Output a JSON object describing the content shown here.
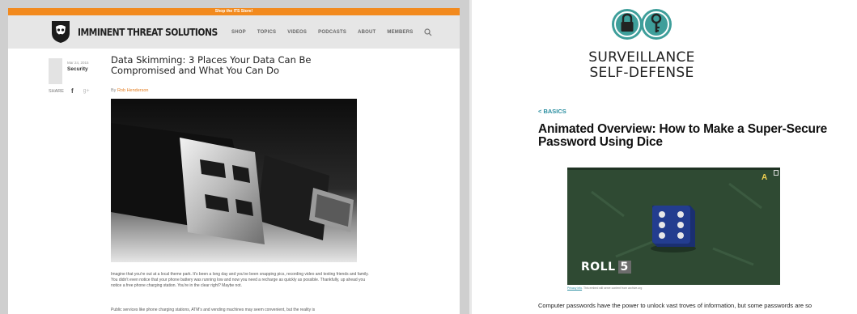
{
  "left_site": {
    "promo_bar": "Shop the ITS Store!",
    "brand": "IMMINENT THREAT SOLUTIONS",
    "nav": [
      "SHOP",
      "TOPICS",
      "VIDEOS",
      "PODCASTS",
      "ABOUT",
      "MEMBERS"
    ],
    "post": {
      "date": "Mar 24, 2015",
      "category": "Security",
      "share_label": "SHARE",
      "share_fb": "f",
      "share_gplus": "g+",
      "title": "Data Skimming: 3 Places Your Data Can Be Compromised and What You Can Do",
      "by": "By",
      "author": "Rob Henderson",
      "paragraph1": "Imagine that you're out at a local theme park. It's been a long day and you've been snapping pics, recording video and texting friends and family. You didn't even notice that your phone battery was running low and now you need a recharge as quickly as possible. Thankfully, up ahead you notice a free phone charging station. You're in the clear right? Maybe not.",
      "paragraph2": "Public services like phone charging stations, ATM's and vending machines may seem convenient, but the reality is"
    },
    "colors": {
      "accent": "#f28a1e",
      "nav_bg": "#e6e6e6"
    }
  },
  "right_site": {
    "logo_line1": "SURVEILLANCE",
    "logo_line2": "SELF-DEFENSE",
    "breadcrumb": "< BASICS",
    "title": "Animated Overview: How to Make a Super-Secure Password Using Dice",
    "video": {
      "caption_word": "ROLL",
      "caption_number": "5",
      "logo": "A",
      "privacy_link": "Privacy info",
      "privacy_text": ". This embed will serve content from archive.org"
    },
    "body_start": "Computer passwords have the power to unlock vast troves of information, but some passwords are so",
    "colors": {
      "accent": "#2a8ea0",
      "logo_teal": "#3e9e9a",
      "video_bg": "#2f4a33",
      "die": "#233d8f"
    }
  }
}
